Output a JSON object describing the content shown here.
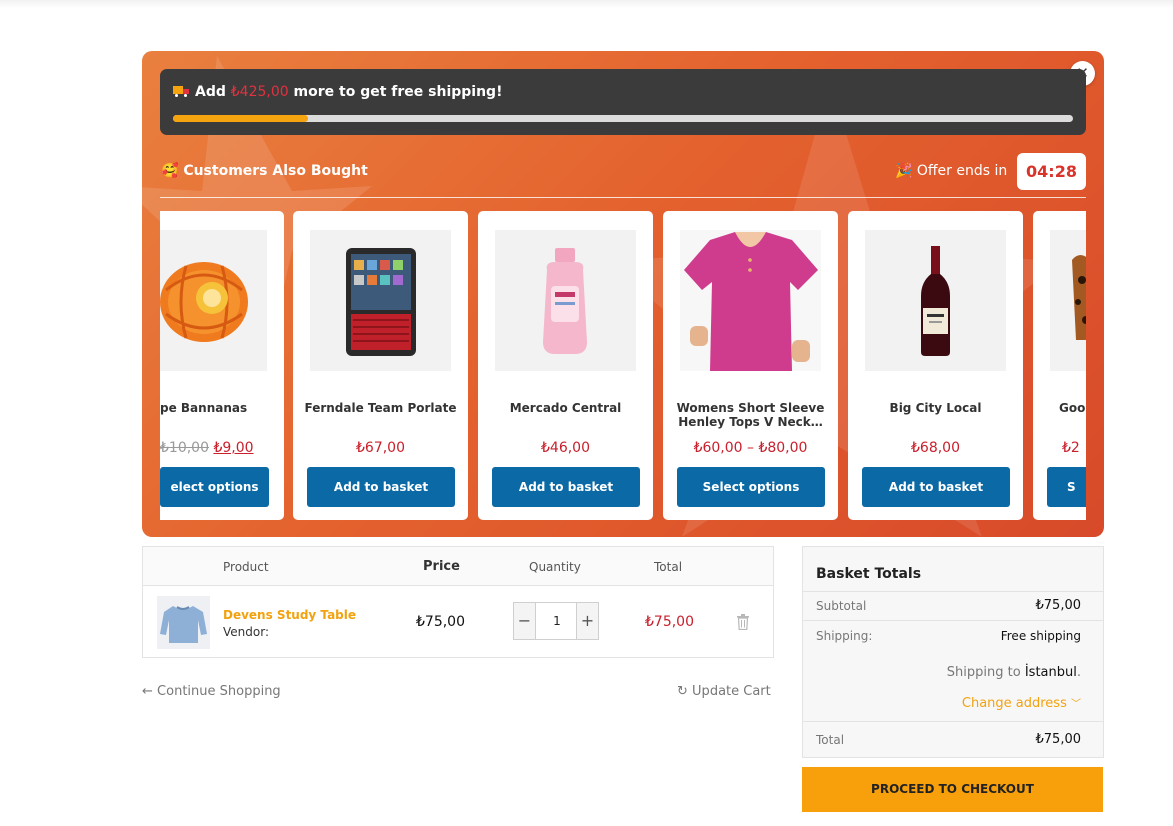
{
  "shipping": {
    "prefix": "Add",
    "amount": "₺425,00",
    "suffix": "more to get free shipping!",
    "progress_fraction": 0.15
  },
  "upsell": {
    "title": "Customers Also Bought",
    "offer_label": "Offer ends in",
    "timer": "04:28",
    "products": [
      {
        "name": "pe Bannanas",
        "old_price": "₺10,00",
        "price": "₺9,00",
        "button": "elect options"
      },
      {
        "name": "Ferndale Team Porlate",
        "price": "₺67,00",
        "button": "Add to basket"
      },
      {
        "name": "Mercado Central",
        "price": "₺46,00",
        "button": "Add to basket"
      },
      {
        "name": "Womens Short Sleeve Henley Tops V Neck…",
        "price": "₺60,00 – ₺80,00",
        "button": "Select options"
      },
      {
        "name": "Big City Local",
        "price": "₺68,00",
        "button": "Add to basket"
      },
      {
        "name": "Goo",
        "price": "₺2",
        "button": "S"
      }
    ]
  },
  "cart": {
    "headers": {
      "product": "Product",
      "price": "Price",
      "quantity": "Quantity",
      "total": "Total"
    },
    "items": [
      {
        "name": "Devens Study Table",
        "vendor": "Vendor:",
        "price": "₺75,00",
        "quantity": "1",
        "total": "₺75,00"
      }
    ],
    "continue_label": "Continue Shopping",
    "update_label": "Update Cart"
  },
  "totals": {
    "title": "Basket Totals",
    "subtotal_label": "Subtotal",
    "subtotal_value": "₺75,00",
    "shipping_label": "Shipping:",
    "shipping_value": "Free shipping",
    "shipping_to_prefix": "Shipping to",
    "shipping_to_city": "İstanbul",
    "change_address": "Change address",
    "total_label": "Total",
    "total_value": "₺75,00",
    "checkout_label": "PROCEED TO CHECKOUT"
  },
  "colors": {
    "accent_orange": "#f8a00b",
    "promo_gradient_start": "#e9803f",
    "promo_gradient_end": "#d84a2a",
    "button_blue": "#0b6aa5",
    "price_red": "#c8202c"
  }
}
